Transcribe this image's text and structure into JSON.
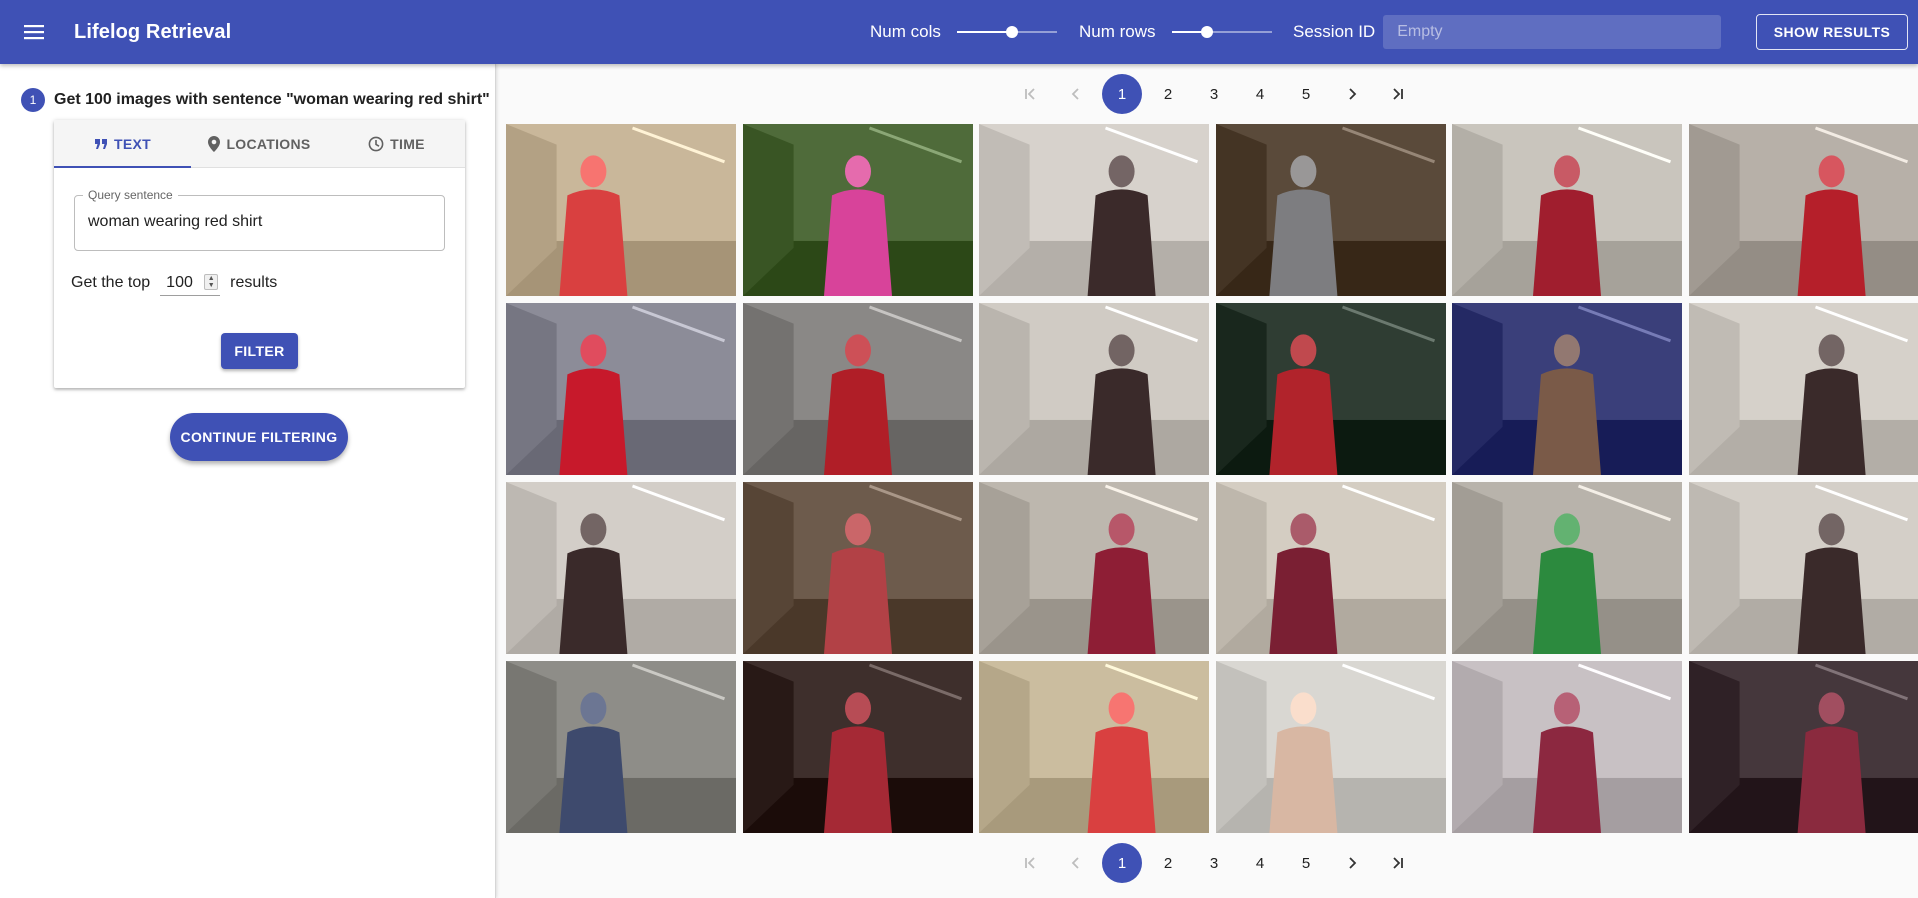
{
  "app": {
    "title": "Lifelog Retrieval",
    "menu_icon": "hamburger-menu-icon"
  },
  "header": {
    "num_cols_label": "Num cols",
    "num_cols_level": 0.55,
    "num_rows_label": "Num rows",
    "num_rows_level": 0.35,
    "session_label": "Session ID",
    "session_placeholder": "Empty",
    "show_results_label": "SHOW RESULTS"
  },
  "step": {
    "number": "1",
    "label": "Get 100 images with sentence \"woman wearing red shirt\""
  },
  "tabs": [
    {
      "label": "TEXT",
      "icon": "quote-icon",
      "active": true
    },
    {
      "label": "LOCATIONS",
      "icon": "location-pin-icon",
      "active": false
    },
    {
      "label": "TIME",
      "icon": "clock-icon",
      "active": false
    }
  ],
  "query": {
    "legend": "Query sentence",
    "value": "woman wearing red shirt",
    "top_prefix": "Get the top",
    "top_value": "100",
    "top_suffix": "results",
    "filter_label": "FILTER"
  },
  "continue_label": "CONTINUE FILTERING",
  "pagination": {
    "pages": [
      "1",
      "2",
      "3",
      "4",
      "5"
    ],
    "current": "1"
  },
  "images": [
    {
      "scene": "office-corridor",
      "bg": "#c9b79a",
      "fg": "#d94040"
    },
    {
      "scene": "outdoor-bushes",
      "bg": "#4f6b3a",
      "fg": "#d8439a"
    },
    {
      "scene": "white-room",
      "bg": "#d7d2cc",
      "fg": "#3b2a2a"
    },
    {
      "scene": "grey-shirt-back",
      "bg": "#5a4a3a",
      "fg": "#7d7d80"
    },
    {
      "scene": "whiteboard-room",
      "bg": "#c9c5bd",
      "fg": "#a01e2e"
    },
    {
      "scene": "red-jumper-close",
      "bg": "#b7b0a8",
      "fg": "#b51f2a"
    },
    {
      "scene": "long-corridor",
      "bg": "#8c8c98",
      "fg": "#c7192b"
    },
    {
      "scene": "elevator",
      "bg": "#8a8886",
      "fg": "#b01e27"
    },
    {
      "scene": "white-room",
      "bg": "#d0cbc4",
      "fg": "#3a2a2a"
    },
    {
      "scene": "phone-hand",
      "bg": "#2f3d33",
      "fg": "#b1232b"
    },
    {
      "scene": "poster-hall",
      "bg": "#3a3f7a",
      "fg": "#7a5a48"
    },
    {
      "scene": "white-room",
      "bg": "#d6d1ca",
      "fg": "#3a2a2a"
    },
    {
      "scene": "white-room",
      "bg": "#d3cec8",
      "fg": "#3a2a2a"
    },
    {
      "scene": "shop-shelves",
      "bg": "#6d5b4c",
      "fg": "#b24146"
    },
    {
      "scene": "office-door",
      "bg": "#bdb7ae",
      "fg": "#8e1e35"
    },
    {
      "scene": "stairs-hall",
      "bg": "#d4cdc2",
      "fg": "#7a1f33"
    },
    {
      "scene": "green-sign",
      "bg": "#b8b3ab",
      "fg": "#2c8a3e"
    },
    {
      "scene": "white-room",
      "bg": "#d4cfc8",
      "fg": "#3a2a2a"
    },
    {
      "scene": "desk-table",
      "bg": "#8e8d88",
      "fg": "#3e4a6d"
    },
    {
      "scene": "dim-room",
      "bg": "#3e2f2c",
      "fg": "#a52935"
    },
    {
      "scene": "office-corridor",
      "bg": "#cbbd9f",
      "fg": "#d94040"
    },
    {
      "scene": "hall-woman",
      "bg": "#d9d7d2",
      "fg": "#d8b7a3"
    },
    {
      "scene": "blurry",
      "bg": "#c8c1c4",
      "fg": "#8c2840"
    },
    {
      "scene": "store-dark",
      "bg": "#45373c",
      "fg": "#8a2a3e"
    }
  ]
}
